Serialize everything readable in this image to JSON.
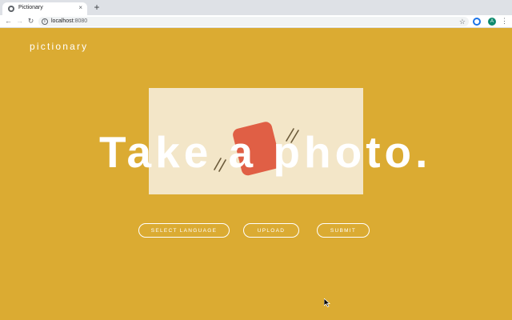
{
  "browser": {
    "tab_title": "Pictionary",
    "tab_close_icon": "close-icon",
    "new_tab_label": "+",
    "url_host": "localhost",
    "url_port": ":8080",
    "profile_initial": "A"
  },
  "page": {
    "brand": "pictionary",
    "headline": "Take a photo.",
    "buttons": {
      "select_language": "SELECT LANGUAGE",
      "upload": "UPLOAD",
      "submit": "SUBMIT"
    },
    "hero_icon": "photo-card-illustration"
  },
  "colors": {
    "background": "#dbab32",
    "card": "#f3e6c8",
    "accent": "#e05f45",
    "text": "#ffffff"
  }
}
